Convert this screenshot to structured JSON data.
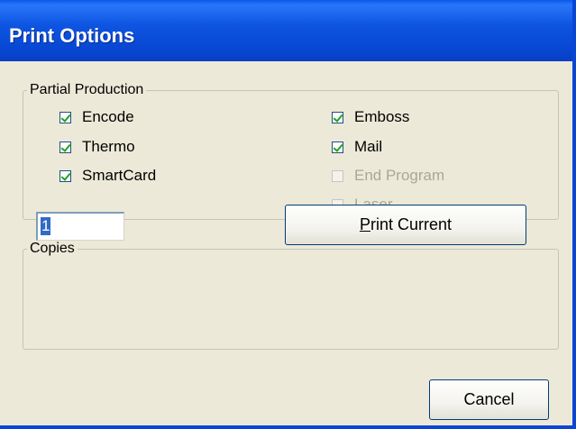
{
  "window": {
    "title": "Print Options"
  },
  "partial_production": {
    "caption": "Partial Production",
    "options": [
      {
        "label": "Encode",
        "checked": true,
        "enabled": true
      },
      {
        "label": "Thermo",
        "checked": true,
        "enabled": true
      },
      {
        "label": "SmartCard",
        "checked": true,
        "enabled": true
      },
      {
        "label": "Emboss",
        "checked": true,
        "enabled": true
      },
      {
        "label": "Mail",
        "checked": true,
        "enabled": true
      },
      {
        "label": "End Program",
        "checked": false,
        "enabled": false
      },
      {
        "label": "Laser",
        "checked": false,
        "enabled": false
      }
    ]
  },
  "copies": {
    "caption": "Copies",
    "value": "1",
    "print_current_mnemonic": "P",
    "print_current_rest": "rint Current"
  },
  "buttons": {
    "cancel": "Cancel"
  },
  "colors": {
    "title_bar": "#0a58ee",
    "face": "#ece9d8",
    "check": "#21a121"
  }
}
